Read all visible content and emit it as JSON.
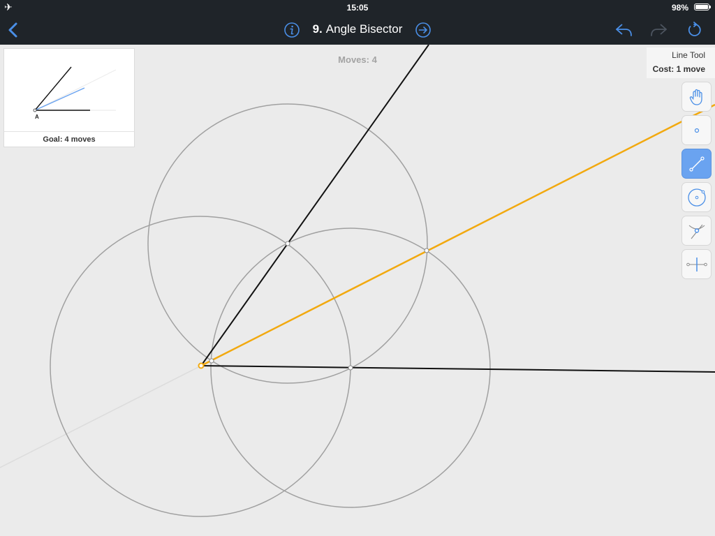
{
  "status_bar": {
    "time": "15:05",
    "battery": "98%",
    "airplane_glyph": "✈"
  },
  "nav": {
    "level_number": "9.",
    "level_title": "Angle Bisector"
  },
  "moves_label": "Moves: 4",
  "goal": {
    "label": "Goal: 4 moves",
    "point_label": "A"
  },
  "tool_info": {
    "name": "Line Tool",
    "cost": "Cost: 1 move"
  },
  "tools": [
    {
      "name": "hand-tool",
      "icon": "hand-icon",
      "active": false
    },
    {
      "name": "point-tool",
      "icon": "point-icon",
      "active": false
    },
    {
      "name": "line-tool",
      "icon": "line-icon",
      "active": true
    },
    {
      "name": "circle-tool",
      "icon": "circle-icon",
      "active": false
    },
    {
      "name": "intersection-tool",
      "icon": "intersect-icon",
      "active": false
    },
    {
      "name": "perpendicular-bisector-tool",
      "icon": "perpendicular-bisector-icon",
      "active": false
    }
  ],
  "colors": {
    "accent": "#4a8fe7",
    "bisector": "#f2a90f",
    "topbar": "#1f2429",
    "circle": "#a0a0a0"
  }
}
